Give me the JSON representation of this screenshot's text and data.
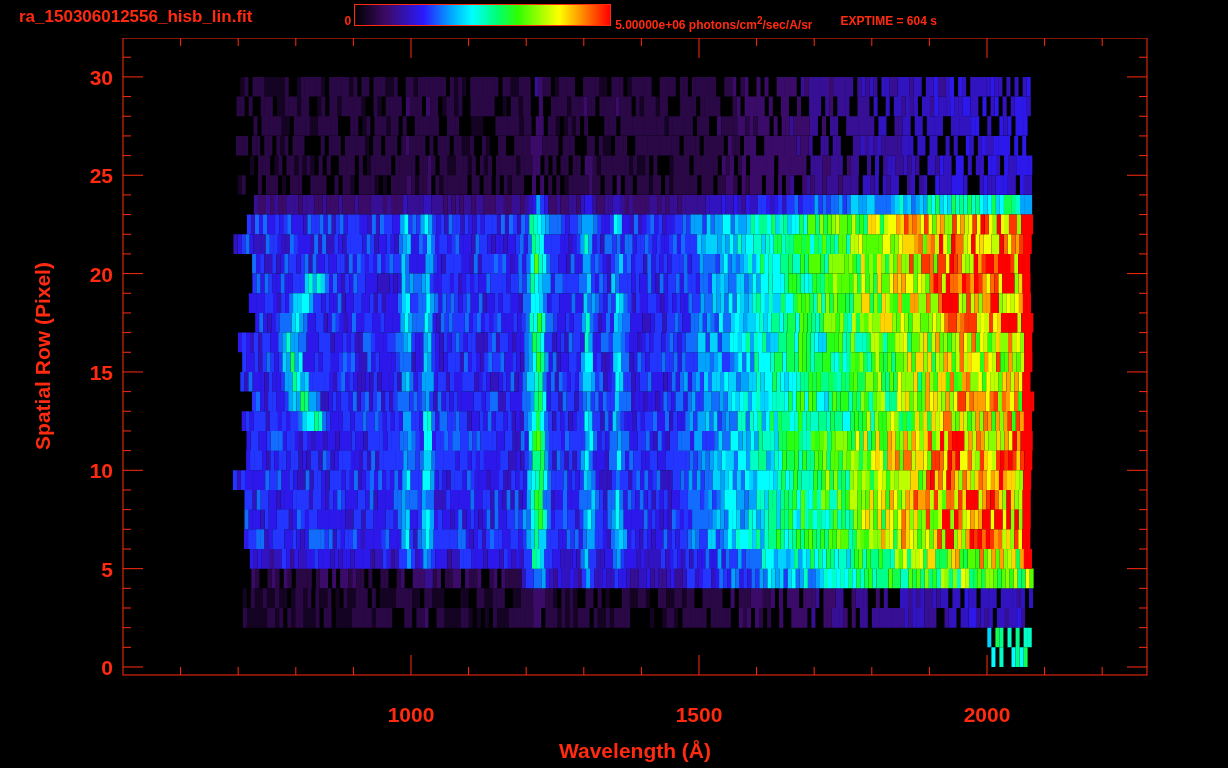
{
  "title": "ra_150306012556_hisb_lin.fit",
  "colorbar": {
    "min_label": "0",
    "max_label": "5.00000e+06 photons/cm$^{2}$/sec/A/sr"
  },
  "exposure": "EXPTIME = 604 s",
  "plot": {
    "xlabel": "Wavelength (Å)",
    "ylabel": "Spatial Row (Pixel)",
    "xticks": [
      "1000",
      "1500",
      "2000"
    ],
    "yticks": [
      "30",
      "25",
      "20",
      "15",
      "10",
      "5",
      "0"
    ]
  }
}
